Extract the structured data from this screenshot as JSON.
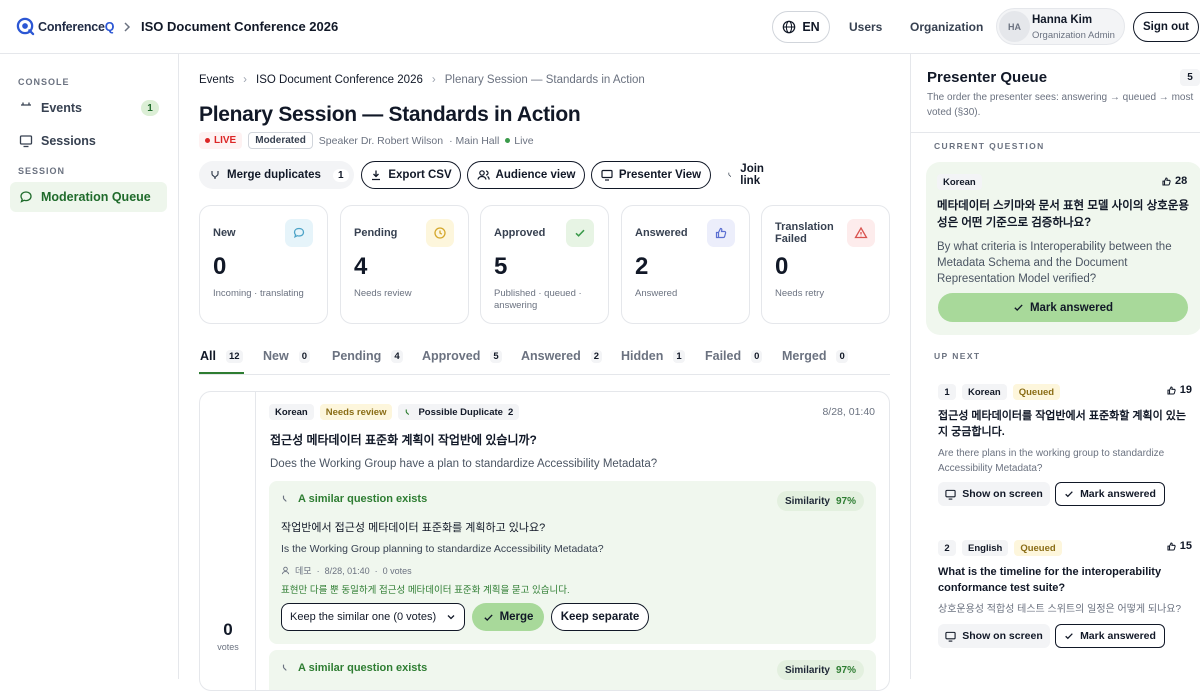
{
  "topbar": {
    "brand_prefix": "Conference",
    "brand_suffix": "Q",
    "event_title": "ISO Document Conference 2026",
    "lang": "EN",
    "nav_users": "Users",
    "nav_org": "Organization",
    "user_initials": "HA",
    "user_name": "Hanna Kim",
    "user_role": "Organization Admin",
    "signout": "Sign out"
  },
  "sidebar": {
    "console_label": "CONSOLE",
    "events_label": "Events",
    "events_count": "1",
    "sessions_label": "Sessions",
    "session_label": "SESSION",
    "moderation_label": "Moderation Queue"
  },
  "breadcrumb": {
    "events": "Events",
    "conference": "ISO Document Conference 2026",
    "session": "Plenary Session — Standards in Action"
  },
  "page": {
    "title": "Plenary Session — Standards in Action",
    "live_badge": "LIVE",
    "moderated_badge": "Moderated",
    "speaker": "Speaker Dr. Robert Wilson",
    "hall": "· Main Hall",
    "status": "Live"
  },
  "actions": {
    "merge_duplicates": "Merge duplicates",
    "merge_count": "1",
    "export_csv": "Export CSV",
    "audience_view": "Audience view",
    "presenter_view": "Presenter View",
    "join_link": "Join link"
  },
  "stats": [
    {
      "label": "New",
      "value": "0",
      "sub": "Incoming · translating",
      "icon": "chat-bubble-icon",
      "color": "#4da3c7",
      "bg": "#e6f4fa"
    },
    {
      "label": "Pending",
      "value": "4",
      "sub": "Needs review",
      "icon": "clock-icon",
      "color": "#d4a72c",
      "bg": "#fdf6dc"
    },
    {
      "label": "Approved",
      "value": "5",
      "sub": "Published · queued · answering",
      "icon": "check-icon",
      "color": "#3a9a4a",
      "bg": "#e7f4e4"
    },
    {
      "label": "Answered",
      "value": "2",
      "sub": "Answered",
      "icon": "thumbs-up-icon",
      "color": "#5b6fd1",
      "bg": "#eceefb"
    },
    {
      "label": "Translation Failed",
      "value": "0",
      "sub": "Needs retry",
      "icon": "warning-icon",
      "color": "#d9534f",
      "bg": "#fdecec"
    }
  ],
  "tabs": [
    {
      "label": "All",
      "count": "12"
    },
    {
      "label": "New",
      "count": "0"
    },
    {
      "label": "Pending",
      "count": "4"
    },
    {
      "label": "Approved",
      "count": "5"
    },
    {
      "label": "Answered",
      "count": "2"
    },
    {
      "label": "Hidden",
      "count": "1"
    },
    {
      "label": "Failed",
      "count": "0"
    },
    {
      "label": "Merged",
      "count": "0"
    }
  ],
  "question": {
    "lang_tag": "Korean",
    "status_tag": "Needs review",
    "dup_tag": "Possible Duplicate",
    "dup_count": "2",
    "time": "8/28, 01:40",
    "text_ko": "접근성 메타데이터 표준화 계획이 작업반에 있습니까?",
    "text_en": "Does the Working Group have a plan to standardize Accessibility Metadata?",
    "votes": "0",
    "votes_label": "votes",
    "similar": {
      "heading": "A similar question exists",
      "similarity_label": "Similarity",
      "similarity_value": "97%",
      "text_ko": "작업반에서 접근성 메타데이터 표준화를 계획하고 있나요?",
      "text_en": "Is the Working Group planning to standardize Accessibility Metadata?",
      "author": "데모",
      "time": "8/28, 01:40",
      "votes": "0 votes",
      "note": "표현만 다를 뿐 동일하게 접근성 메타데이터 표준화 계획을 묻고 있습니다.",
      "select_value": "Keep the similar one (0 votes)",
      "merge": "Merge",
      "keep": "Keep separate"
    },
    "similar2_heading": "A similar question exists",
    "similar2_similarity_label": "Similarity",
    "similar2_similarity_value": "97%"
  },
  "presenter": {
    "title": "Presenter Queue",
    "count": "5",
    "desc": "The order the presenter sees: answering → queued → most voted (§30).",
    "current_label": "CURRENT QUESTION",
    "current": {
      "lang": "Korean",
      "likes": "28",
      "text_ko": "메타데이터 스키마와 문서 표현 모델 사이의 상호운용성은 어떤 기준으로 검증하나요?",
      "text_en": "By what criteria is Interoperability between the Metadata Schema and the Document Representation Model verified?",
      "mark": "Mark answered"
    },
    "upnext_label": "UP NEXT",
    "next": [
      {
        "num": "1",
        "lang": "Korean",
        "status": "Queued",
        "likes": "19",
        "text": "접근성 메타데이터를 작업반에서 표준화할 계획이 있는지 궁금합니다.",
        "sub": "Are there plans in the working group to standardize Accessibility Metadata?",
        "show": "Show on screen",
        "mark": "Mark answered"
      },
      {
        "num": "2",
        "lang": "English",
        "status": "Queued",
        "likes": "15",
        "text": "What is the timeline for the interoperability conformance test suite?",
        "sub": "상호운용성 적합성 테스트 스위트의 일정은 어떻게 되나요?",
        "show": "Show on screen",
        "mark": "Mark answered"
      }
    ]
  }
}
